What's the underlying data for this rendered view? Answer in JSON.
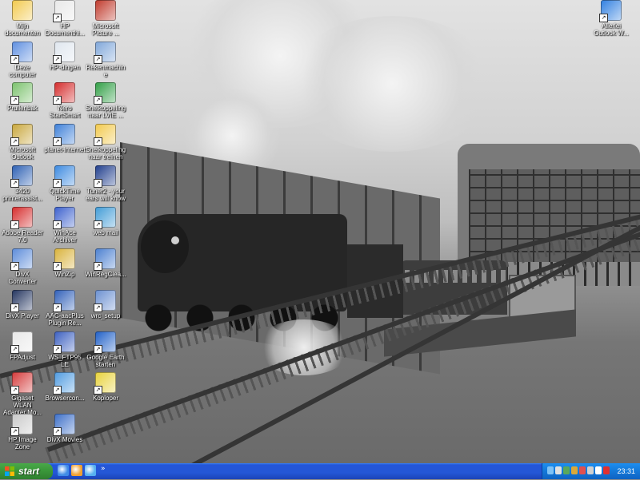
{
  "desktop": {
    "icons": [
      {
        "label": "Mijn documenten",
        "icon": "my-documents-folder-icon",
        "color": "#f2c94c"
      },
      {
        "label": "HP Documenthi...",
        "icon": "hp-document-icon",
        "color": "#e8e8e8"
      },
      {
        "label": "Microsoft Picture ...",
        "icon": "picture-manager-icon",
        "color": "#c0392b"
      },
      {
        "label": "Deze computer",
        "icon": "my-computer-icon",
        "color": "#5d8ee0"
      },
      {
        "label": "HP-dingen",
        "icon": "hp-program-icon",
        "color": "#dfe6ee"
      },
      {
        "label": "Rekenmachine",
        "icon": "calculator-icon",
        "color": "#7fa6d9"
      },
      {
        "label": "Prullenbak",
        "icon": "recycle-bin-icon",
        "color": "#7ac16b"
      },
      {
        "label": "Nero StartSmart",
        "icon": "nero-icon",
        "color": "#d42a2a"
      },
      {
        "label": "Snelkoppeling naar LVIE ...",
        "icon": "lvie-icon",
        "color": "#2f9e44"
      },
      {
        "label": "Microsoft Outlook",
        "icon": "outlook-icon",
        "color": "#c8a63a"
      },
      {
        "label": "planet-internet",
        "icon": "planet-internet-icon",
        "color": "#3c7fd8"
      },
      {
        "label": "Snelkoppeling naar treinen",
        "icon": "folder-icon",
        "color": "#f2c94c"
      },
      {
        "label": "3420 printerassist...",
        "icon": "hp-printer-icon",
        "color": "#2b5fb3"
      },
      {
        "label": "QuickTime Player",
        "icon": "quicktime-icon",
        "color": "#3a89e0"
      },
      {
        "label": "Tuner2 - your ears will know",
        "icon": "tuner-icon",
        "color": "#1e3c8c"
      },
      {
        "label": "Adobe Reader 7.0",
        "icon": "adobe-reader-icon",
        "color": "#d62a2a"
      },
      {
        "label": "WinAce Archiver",
        "icon": "winace-icon",
        "color": "#3a5fcd"
      },
      {
        "label": "web mail",
        "icon": "web-mail-icon",
        "color": "#3f9bd6"
      },
      {
        "label": "DivX Converter",
        "icon": "divx-converter-icon",
        "color": "#5b8bd9"
      },
      {
        "label": "WinZip",
        "icon": "winzip-icon",
        "color": "#d9b23a"
      },
      {
        "label": "WinRegClea...",
        "icon": "winregclean-icon",
        "color": "#4a7fd0"
      },
      {
        "label": "DivX Player",
        "icon": "divx-player-icon",
        "color": "#22335e"
      },
      {
        "label": "AAC-aacPlus Plugin Re...",
        "icon": "word-document-icon",
        "color": "#2f5fb8"
      },
      {
        "label": "wrc_setup",
        "icon": "setup-icon",
        "color": "#6a8fd0"
      },
      {
        "label": "FPAdjust",
        "icon": "fpadjust-icon",
        "color": "#e8e8e8"
      },
      {
        "label": "WS_FTP95 LE",
        "icon": "ws-ftp-icon",
        "color": "#3b5fc0"
      },
      {
        "label": "Google Earth starten",
        "icon": "google-earth-icon",
        "color": "#1f5fc7"
      },
      {
        "label": "Gigaset WLAN Adapter Mo...",
        "icon": "gigaset-icon",
        "color": "#d43a3a"
      },
      {
        "label": "Browsercon...",
        "icon": "browser-config-icon",
        "color": "#4f9be0"
      },
      {
        "label": "Koploper",
        "icon": "koploper-icon",
        "color": "#e8d23a"
      },
      {
        "label": "HP Image Zone",
        "icon": "hp-image-zone-icon",
        "color": "#c9c9c9"
      },
      {
        "label": "DivX Movies",
        "icon": "divx-movies-icon",
        "color": "#3c6fc8"
      },
      {
        "label": "Allerlei Outlook W...",
        "icon": "internet-explorer-icon",
        "color": "#2f7fe0"
      }
    ]
  },
  "taskbar": {
    "start_label": "start",
    "quicklaunch": [
      {
        "icon": "show-desktop-icon",
        "color": "#3f8be6"
      },
      {
        "icon": "media-player-icon",
        "color": "#f0a030"
      },
      {
        "icon": "internet-explorer-icon",
        "color": "#56b0f0"
      }
    ],
    "quicklaunch_more": "»",
    "tray": [
      {
        "icon": "ie-tray-icon",
        "color": "#7fc2f5"
      },
      {
        "icon": "network-tray-icon",
        "color": "#e0e0e0"
      },
      {
        "icon": "shield-tray-icon",
        "color": "#5aa85a"
      },
      {
        "icon": "wlan-tray-icon",
        "color": "#d9a83a"
      },
      {
        "icon": "security-tray-icon",
        "color": "#e05050"
      },
      {
        "icon": "update-tray-icon",
        "color": "#d0d0d0"
      },
      {
        "icon": "volume-tray-icon",
        "color": "#ffffff"
      },
      {
        "icon": "alert-tray-icon",
        "color": "#e03030"
      }
    ],
    "clock": "23:31"
  }
}
